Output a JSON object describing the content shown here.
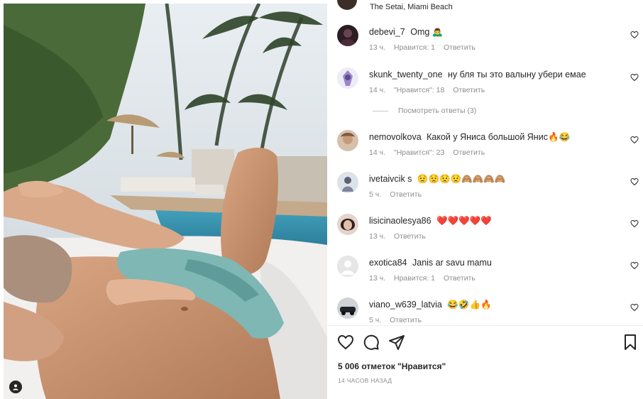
{
  "location": "The Setai, Miami Beach",
  "comments": [
    {
      "user": "debevi_7",
      "text": "Omg 🙇‍♂️",
      "time": "13 ч.",
      "likes": "Нравится: 1",
      "reply": "Ответить",
      "avatar_color": "#2b1d24"
    },
    {
      "user": "skunk_twenty_one",
      "text": "ну бля ты это валыну убери емае",
      "time": "14 ч.",
      "likes": "\"Нравится\": 18",
      "reply": "Ответить",
      "avatar_color": "#d9d1ee"
    },
    {
      "user": "nemovolkova",
      "text": "Какой у Яниса большой Янис🔥😂",
      "time": "14 ч.",
      "likes": "\"Нравится\": 23",
      "reply": "Ответить",
      "avatar_color": "#c9a98e"
    },
    {
      "user": "ivetaivcik s",
      "text": "😟😟😟😟🙈🙈🙈🙈",
      "time": "5 ч.",
      "likes": "",
      "reply": "Ответить",
      "avatar_color": "#9aa0b0"
    },
    {
      "user": "lisicinaolesya86",
      "text": "❤️❤️❤️❤️❤️",
      "time": "13 ч.",
      "likes": "",
      "reply": "Ответить",
      "avatar_color": "#3a2a2a"
    },
    {
      "user": "exotica84",
      "text": "Janis ar savu mamu",
      "time": "13 ч.",
      "likes": "Нравится: 1",
      "reply": "Ответить",
      "avatar_color": "#e2e2e2"
    },
    {
      "user": "viano_w639_latvia",
      "text": "😂🤣👍🔥",
      "time": "5 ч.",
      "likes": "",
      "reply": "Ответить",
      "avatar_color": "#4b4f58"
    }
  ],
  "view_replies": "Посмотреть ответы (3)",
  "likes_total": "5 006 отметок \"Нравится\"",
  "time_ago": "14 ЧАСОВ НАЗАД",
  "icons": [
    "heart-icon",
    "comment-icon",
    "share-icon",
    "bookmark-icon"
  ]
}
